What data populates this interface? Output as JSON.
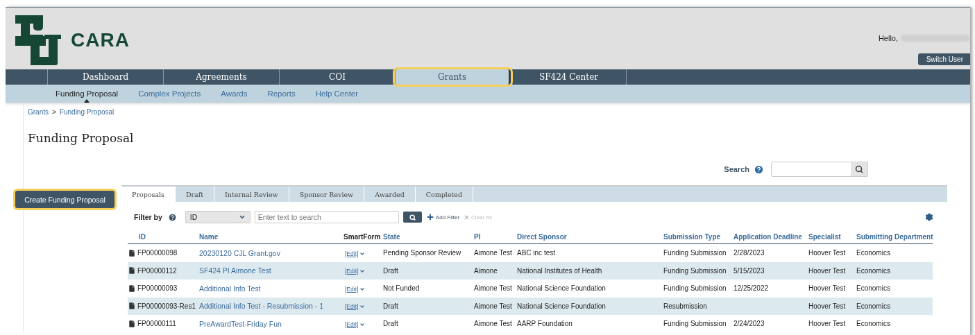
{
  "header": {
    "logo_text": "CARA",
    "greeting": "Hello,",
    "switch_user": "Switch User"
  },
  "nav": [
    {
      "label": "Dashboard",
      "selected": false,
      "highlighted": false
    },
    {
      "label": "Agreements",
      "selected": false,
      "highlighted": false
    },
    {
      "label": "COI",
      "selected": false,
      "highlighted": false
    },
    {
      "label": "Grants",
      "selected": true,
      "highlighted": true
    },
    {
      "label": "SF424 Center",
      "selected": false,
      "highlighted": false
    }
  ],
  "subnav": [
    {
      "label": "Funding Proposal",
      "selected": true
    },
    {
      "label": "Complex Projects",
      "selected": false
    },
    {
      "label": "Awards",
      "selected": false
    },
    {
      "label": "Reports",
      "selected": false
    },
    {
      "label": "Help Center",
      "selected": false
    }
  ],
  "breadcrumb": {
    "items": [
      "Grants",
      "Funding Proposal"
    ],
    "separator": ">"
  },
  "page_title": "Funding Proposal",
  "search": {
    "label": "Search"
  },
  "create_button": {
    "label": "Create Funding Proposal",
    "highlighted": true
  },
  "tabs": [
    {
      "label": "Proposals",
      "selected": true
    },
    {
      "label": "Draft",
      "selected": false
    },
    {
      "label": "Internal Review",
      "selected": false
    },
    {
      "label": "Sponsor Review",
      "selected": false
    },
    {
      "label": "Awarded",
      "selected": false
    },
    {
      "label": "Completed",
      "selected": false
    }
  ],
  "filter": {
    "label": "Filter by",
    "field_value": "ID",
    "placeholder": "Enter text to search",
    "add_filter": "Add Filter",
    "clear_all": "Clear All"
  },
  "table": {
    "columns": [
      {
        "kind": "record",
        "label": "ID",
        "sortable": true
      },
      {
        "kind": "link",
        "label": "Name",
        "sortable": true
      },
      {
        "kind": "menu",
        "label": "SmartForm",
        "sortable": false
      },
      {
        "kind": "text",
        "label": "State",
        "sortable": true
      },
      {
        "kind": "text",
        "label": "PI",
        "sortable": true
      },
      {
        "kind": "text",
        "label": "Direct Sponsor",
        "sortable": true
      },
      {
        "kind": "text",
        "label": "Submission Type",
        "sortable": true
      },
      {
        "kind": "text",
        "label": "Application Deadline",
        "sortable": true
      },
      {
        "kind": "text",
        "label": "Specialist",
        "sortable": true
      },
      {
        "kind": "text",
        "label": "Submitting Department",
        "sortable": true
      }
    ],
    "rows": [
      [
        "FP00000098",
        "20230120 CJL Grant.gov",
        "[Edit]",
        "Pending Sponsor Review",
        "Aimone Test",
        "ABC inc test",
        "Funding Submission",
        "2/28/2023",
        "Hoover Test",
        "Economics"
      ],
      [
        "FP00000112",
        "SF424 PI Aimone Test",
        "[Edit]",
        "Draft",
        "Aimone",
        "National Institutes of Health",
        "Funding Submission",
        "5/15/2023",
        "Hoover Test",
        "Economics"
      ],
      [
        "FP00000093",
        "Additional Info Test",
        "[Edit]",
        "Not Funded",
        "Aimone Test",
        "National Science Foundation",
        "Funding Submission",
        "12/25/2022",
        "Hoover Test",
        "Economics"
      ],
      [
        "FP00000093-Res1",
        "Additional Info Test - Resubmission - 1",
        "[Edit]",
        "Draft",
        "Aimone Test",
        "National Science Foundation",
        "Resubmission",
        null,
        "Hoover Test",
        "Economics"
      ],
      [
        "FP00000111",
        "PreAwardTest-Friday Fun",
        "[Edit]",
        "Draft",
        "Aimone Test",
        "AARP Foundation",
        "Funding Submission",
        "2/24/2023",
        "Hoover Test",
        "Economics"
      ]
    ]
  }
}
